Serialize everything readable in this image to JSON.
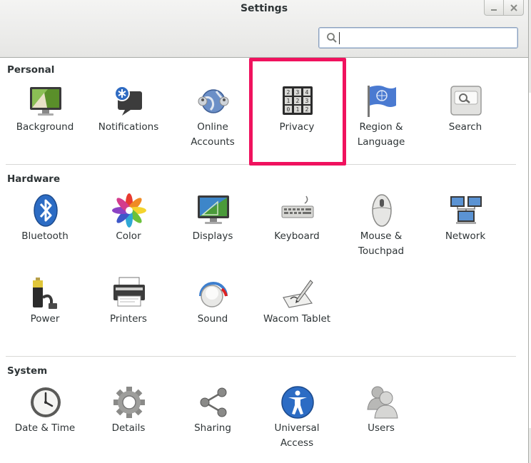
{
  "window": {
    "title": "Settings"
  },
  "search": {
    "placeholder": "",
    "value": ""
  },
  "sections": {
    "personal": {
      "title": "Personal",
      "items": [
        {
          "label": "Background",
          "icon": "background-icon"
        },
        {
          "label": "Notifications",
          "icon": "notifications-icon"
        },
        {
          "label": "Online\nAccounts",
          "icon": "online-accounts-icon"
        },
        {
          "label": "Privacy",
          "icon": "privacy-icon"
        },
        {
          "label": "Region &\nLanguage",
          "icon": "region-language-icon"
        },
        {
          "label": "Search",
          "icon": "search-settings-icon"
        }
      ]
    },
    "hardware": {
      "title": "Hardware",
      "items": [
        {
          "label": "Bluetooth",
          "icon": "bluetooth-icon"
        },
        {
          "label": "Color",
          "icon": "color-icon"
        },
        {
          "label": "Displays",
          "icon": "displays-icon"
        },
        {
          "label": "Keyboard",
          "icon": "keyboard-icon"
        },
        {
          "label": "Mouse &\nTouchpad",
          "icon": "mouse-icon"
        },
        {
          "label": "Network",
          "icon": "network-icon"
        },
        {
          "label": "Power",
          "icon": "power-icon"
        },
        {
          "label": "Printers",
          "icon": "printers-icon"
        },
        {
          "label": "Sound",
          "icon": "sound-icon"
        },
        {
          "label": "Wacom Tablet",
          "icon": "wacom-tablet-icon"
        }
      ]
    },
    "system": {
      "title": "System",
      "items": [
        {
          "label": "Date & Time",
          "icon": "clock-icon"
        },
        {
          "label": "Details",
          "icon": "gear-icon"
        },
        {
          "label": "Sharing",
          "icon": "share-icon"
        },
        {
          "label": "Universal\nAccess",
          "icon": "universal-access-icon"
        },
        {
          "label": "Users",
          "icon": "users-icon"
        }
      ]
    }
  },
  "colors": {
    "highlight": "#f0125e",
    "accent": "#8ba0bd"
  }
}
